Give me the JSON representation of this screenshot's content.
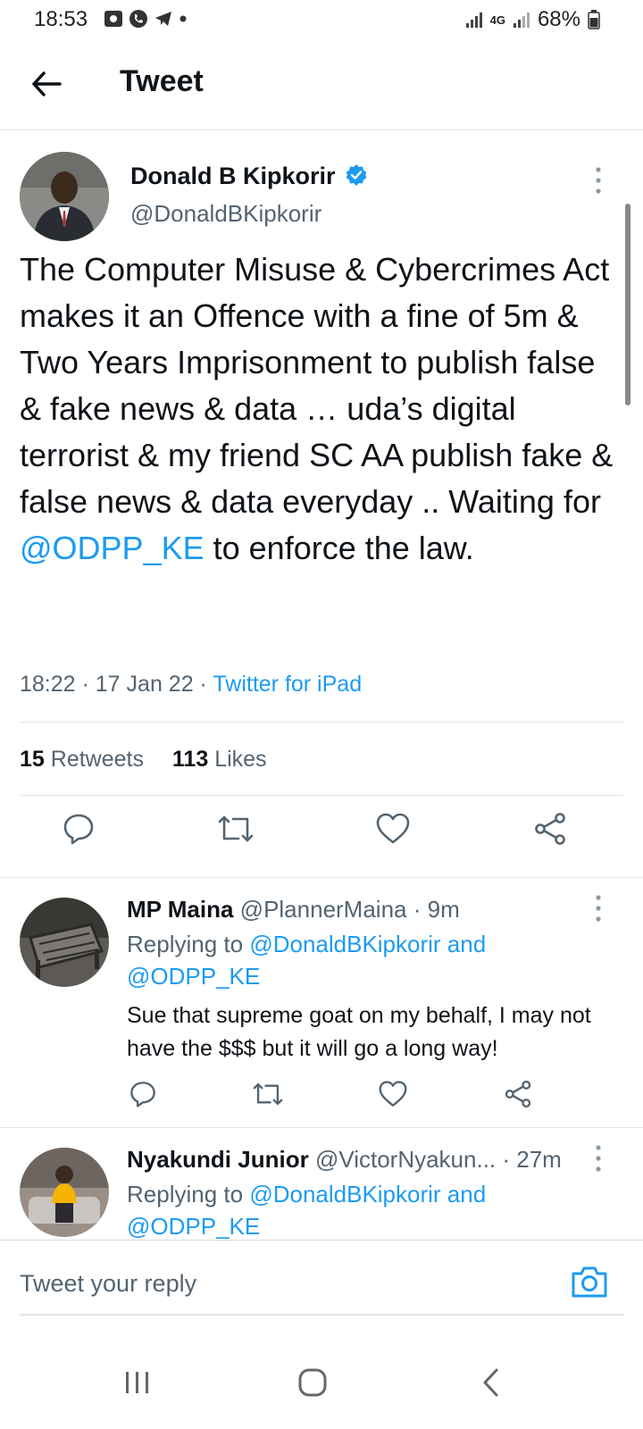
{
  "status_bar": {
    "time": "18:53",
    "network": "4G",
    "battery": "68%"
  },
  "header": {
    "title": "Tweet"
  },
  "tweet": {
    "author_name": "Donald B Kipkorir",
    "author_handle": "@DonaldBKipkorir",
    "text_before_mention": "The Computer Misuse & Cybercrimes Act makes it an Offence with a fine of 5m & Two Years Imprisonment to publish false & fake news & data … uda’s digital terrorist & my friend SC AA publish fake & false news & data everyday .. Waiting for ",
    "mention": "@ODPP_KE",
    "text_after_mention": " to enforce the law.",
    "time": "18:22",
    "date": "17 Jan 22",
    "source": "Twitter for iPad",
    "retweets_count": "15",
    "retweets_label": "Retweets",
    "likes_count": "113",
    "likes_label": "Likes"
  },
  "replies": [
    {
      "name": "MP Maina",
      "handle": "@PlannerMaina",
      "age": "9m",
      "replying_prefix": "Replying to ",
      "replying_to_1": "@DonaldBKipkorir",
      "replying_and": " and",
      "replying_to_2": "@ODPP_KE",
      "text": "Sue that supreme goat on my behalf, I may not have the $$$ but it will go a long way!"
    },
    {
      "name": "Nyakundi Junior",
      "handle": "@VictorNyakun...",
      "age": "27m",
      "replying_prefix": "Replying to ",
      "replying_to_1": "@DonaldBKipkorir",
      "replying_and": " and",
      "replying_to_2": "@ODPP_KE"
    }
  ],
  "compose": {
    "placeholder": "Tweet your reply"
  },
  "icons": {
    "back": "arrow-left-icon",
    "verified": "verified-badge-icon",
    "more": "more-vertical-icon",
    "reply": "reply-icon",
    "retweet": "retweet-icon",
    "like": "heart-icon",
    "share": "share-icon",
    "camera": "camera-icon",
    "recents": "recents-icon",
    "home": "home-icon",
    "nav_back": "nav-back-icon"
  },
  "colors": {
    "accent": "#1d9bf0",
    "text": "#0f1419",
    "secondary": "#536471"
  }
}
